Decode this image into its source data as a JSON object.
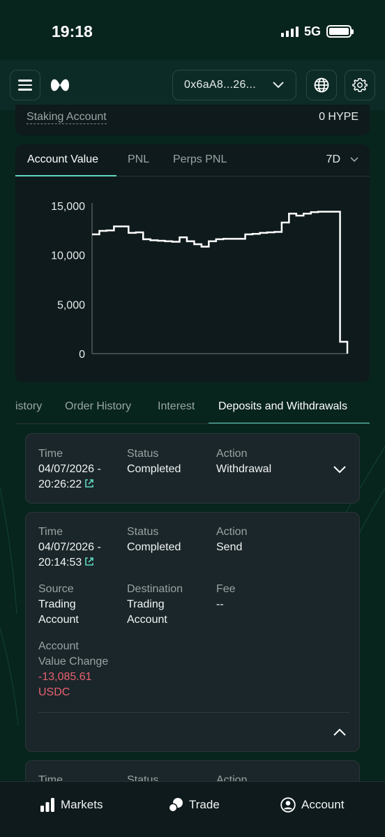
{
  "status_bar": {
    "time": "19:18",
    "network": "5G"
  },
  "header": {
    "address": "0x6aA8...26..."
  },
  "staking": {
    "label": "Staking Account",
    "value": "0 HYPE"
  },
  "chart_tabs": [
    "Account Value",
    "PNL",
    "Perps PNL"
  ],
  "chart_range": "7D",
  "chart_data": {
    "type": "line",
    "step": true,
    "y_ticks": [
      "15,000",
      "10,000",
      "5,000",
      "0"
    ],
    "ylim": [
      0,
      15000
    ],
    "x": [
      0,
      1,
      2,
      3,
      4,
      5,
      6,
      7,
      8,
      9,
      10,
      11,
      12,
      13,
      14,
      15,
      16,
      17,
      18,
      19,
      20,
      21,
      22,
      23,
      24,
      25,
      26,
      27,
      28,
      29,
      30,
      31,
      32,
      33,
      34,
      35
    ],
    "values": [
      12100,
      12450,
      12500,
      12900,
      12900,
      12250,
      12300,
      11600,
      11500,
      11450,
      11400,
      11350,
      11800,
      11400,
      11100,
      10850,
      11400,
      11600,
      11650,
      11650,
      11650,
      12100,
      12150,
      12250,
      12300,
      12350,
      13300,
      14200,
      14000,
      14200,
      14350,
      14400,
      14400,
      14400,
      1200,
      0
    ]
  },
  "history_tabs": [
    "istory",
    "Order History",
    "Interest",
    "Deposits and Withdrawals"
  ],
  "records": [
    {
      "time_label": "Time",
      "time_date": "04/07/2026 -",
      "time_clock": "20:26:22",
      "status_label": "Status",
      "status": "Completed",
      "action_label": "Action",
      "action": "Withdrawal"
    },
    {
      "time_label": "Time",
      "time_date": "04/07/2026 -",
      "time_clock": "20:14:53",
      "status_label": "Status",
      "status": "Completed",
      "action_label": "Action",
      "action": "Send",
      "source_label": "Source",
      "source_1": "Trading",
      "source_2": "Account",
      "destination_label": "Destination",
      "destination_1": "Trading",
      "destination_2": "Account",
      "fee_label": "Fee",
      "fee": "--",
      "avc_label_1": "Account",
      "avc_label_2": "Value Change",
      "avc_value": "-13,085.61",
      "avc_unit": "USDC"
    },
    {
      "time_label": "Time",
      "status_label": "Status",
      "action_label": "Action"
    }
  ],
  "bottom_nav": {
    "markets": "Markets",
    "trade": "Trade",
    "account": "Account"
  },
  "colors": {
    "accent": "#5fd8c1",
    "negative": "#e8616f",
    "background": "#07241d",
    "card": "#1b262a"
  }
}
